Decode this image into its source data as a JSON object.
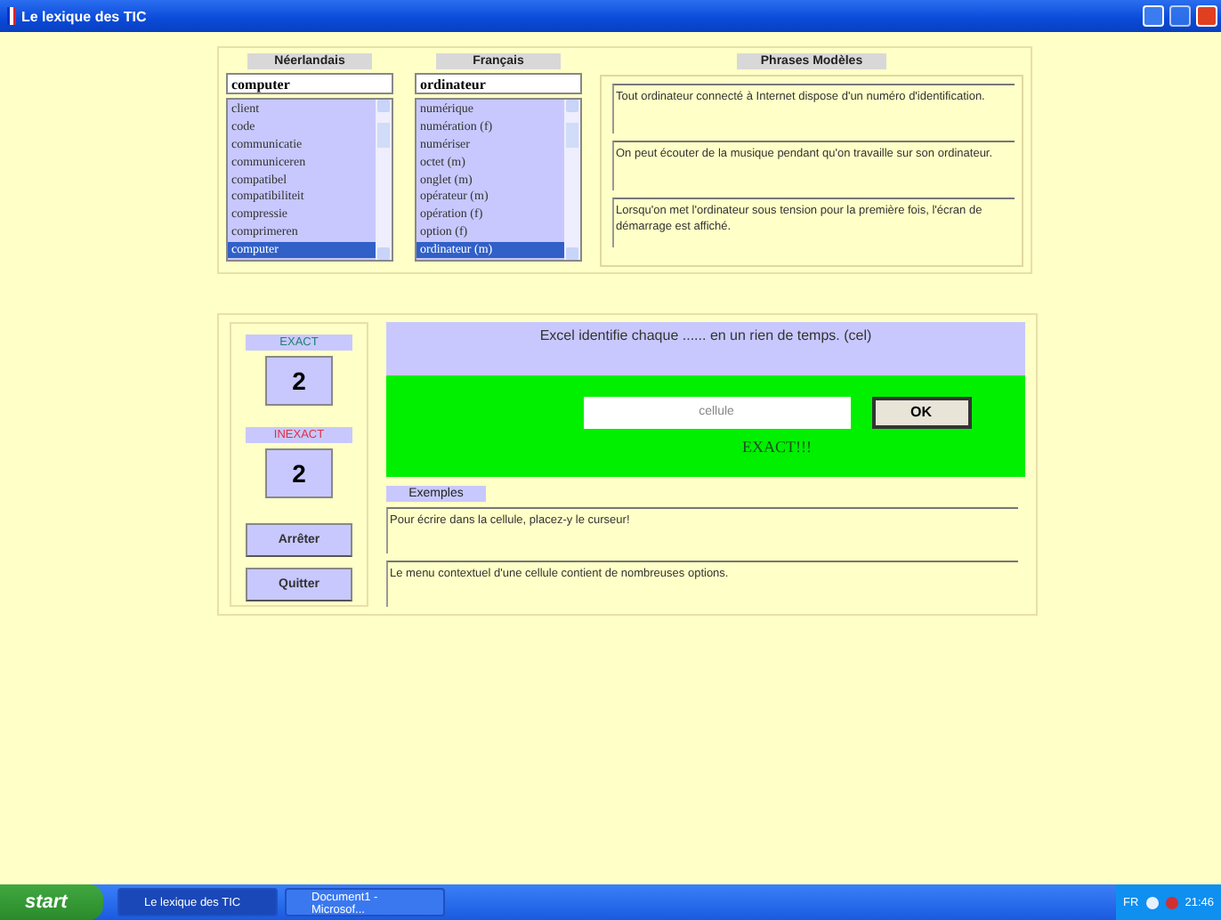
{
  "window": {
    "title": "Le lexique des TIC"
  },
  "lexicon": {
    "columns": [
      {
        "heading": "Néerlandais",
        "value": "computer",
        "items": [
          {
            "label": "client",
            "selected": false
          },
          {
            "label": "code",
            "selected": false
          },
          {
            "label": "communicatie",
            "selected": false
          },
          {
            "label": "communiceren",
            "selected": false
          },
          {
            "label": "compatibel",
            "selected": false
          },
          {
            "label": "compatibiliteit",
            "selected": false
          },
          {
            "label": "compressie",
            "selected": false
          },
          {
            "label": "comprimeren",
            "selected": false
          },
          {
            "label": "computer",
            "selected": true
          }
        ]
      },
      {
        "heading": "Français",
        "value": "ordinateur",
        "items": [
          {
            "label": "numérique",
            "selected": false
          },
          {
            "label": "numération (f)",
            "selected": false
          },
          {
            "label": "numériser",
            "selected": false
          },
          {
            "label": "octet (m)",
            "selected": false
          },
          {
            "label": "onglet (m)",
            "selected": false
          },
          {
            "label": "opérateur (m)",
            "selected": false
          },
          {
            "label": "opération (f)",
            "selected": false
          },
          {
            "label": "option (f)",
            "selected": false
          },
          {
            "label": "ordinateur (m)",
            "selected": true
          }
        ]
      }
    ],
    "phrases_heading": "Phrases Modèles",
    "phrases": [
      "Tout ordinateur connecté à Internet dispose d'un numéro d'identification.",
      "On peut écouter de la musique pendant qu'on travaille sur son ordinateur.",
      "Lorsqu'on met l'ordinateur sous tension pour la première fois, l'écran de démarrage est affiché."
    ]
  },
  "quiz": {
    "exact_label": "EXACT",
    "exact_count": "2",
    "inexact_label": "INEXACT",
    "inexact_count": "2",
    "buttons": [
      "Arrêter",
      "Quitter"
    ],
    "question": "Excel identifie chaque ...... en un rien de temps. (cel)",
    "answer": "cellule",
    "ok": "OK",
    "result": "EXACT!!!",
    "correct": true,
    "examples_heading": "Exemples",
    "examples": [
      "Pour écrire dans la cellule, placez-y le curseur!",
      "Le menu contextuel d'une cellule contient de nombreuses options."
    ]
  },
  "taskbar": {
    "start": "start",
    "tasks": [
      {
        "label": "Le lexique des TIC",
        "selected": true
      },
      {
        "label": "Document1 - Microsof...",
        "selected": false
      }
    ],
    "language": "FR",
    "clock": "21:46"
  }
}
